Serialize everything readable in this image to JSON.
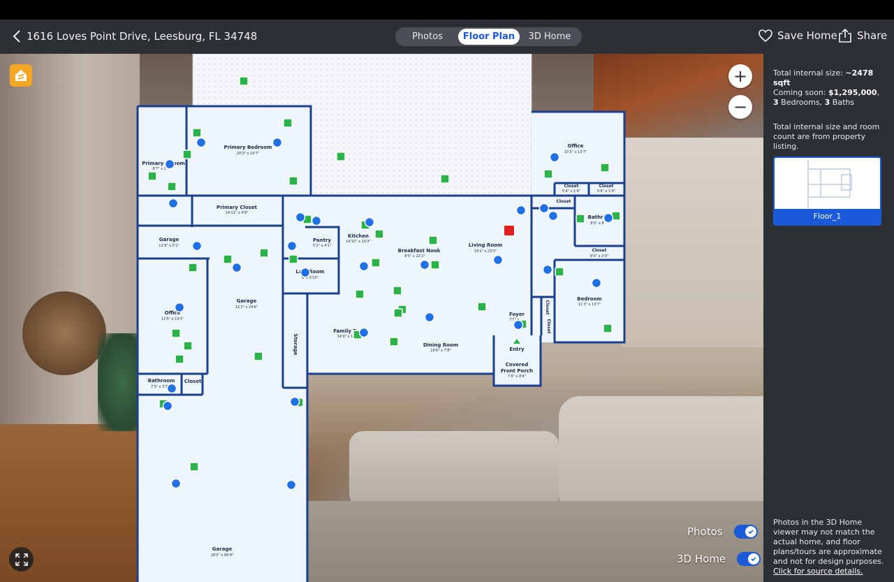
{
  "header": {
    "address": "1616 Loves Point Drive, Leesburg, FL 34748",
    "tabs": [
      {
        "label": "Photos",
        "active": false
      },
      {
        "label": "Floor Plan",
        "active": true
      },
      {
        "label": "3D Home",
        "active": false
      }
    ],
    "save_label": "Save Home",
    "share_label": "Share"
  },
  "viewer": {
    "brand_icon": "zillow-home-icon",
    "zoom_in_label": "+",
    "zoom_out_label": "−",
    "toggles": [
      {
        "label": "Photos",
        "on": true
      },
      {
        "label": "3D Home",
        "on": true
      }
    ],
    "rooms": [
      {
        "name": "Primary Bedroom",
        "dims": "20'3\" x 14'7\""
      },
      {
        "name": "Primary Bathroom",
        "name_visible": "Primary B     room",
        "dims": "8'7\" x 1"
      },
      {
        "name": "Primary Closet",
        "dims": "14'11\" x 4'9\""
      },
      {
        "name": "Garage",
        "dims": "11'9\" x 5'1\""
      },
      {
        "name": "Garage",
        "dims": "12'2\" x 24'6\""
      },
      {
        "name": "Office",
        "dims": "11'5\" x 19'1\""
      },
      {
        "name": "Bathroom",
        "dims": "7'3\" x 3'7\""
      },
      {
        "name": "Closet",
        "dims": ""
      },
      {
        "name": "Garage",
        "dims": "28'5\" x 60'4\""
      },
      {
        "name": "Pantry",
        "dims": "5'2\" x 4'1\""
      },
      {
        "name": "Kitchen",
        "dims": "14'10\" x 16'3\""
      },
      {
        "name": "Laundry Room",
        "name_visible": "La     y Room",
        "dims": "9'     x 5'10\""
      },
      {
        "name": "Storage",
        "dims": ""
      },
      {
        "name": "Family R",
        "dims": "14'9\" x 1"
      },
      {
        "name": "Breakfast Nook",
        "dims": "8'5\" x 22'2\""
      },
      {
        "name": "Living Room",
        "dims": "14'2\" x 23'3\""
      },
      {
        "name": "Dining Room",
        "dims": "16'6\" x 7'8\""
      },
      {
        "name": "Foyer",
        "dims": "7'7\" x"
      },
      {
        "name": "Entry",
        "dims": ""
      },
      {
        "name": "Covered Front Porch",
        "dims": "7'8\" x 8'4\""
      },
      {
        "name": "Office",
        "dims": "15'5\" x 13'7\""
      },
      {
        "name": "Closet",
        "dims": "5'4\" x 1'9\""
      },
      {
        "name": "Closet",
        "dims": "5'8\" x 1'9\""
      },
      {
        "name": "Closet",
        "dims": ""
      },
      {
        "name": "Bathroom",
        "name_visible": "Bathro",
        "dims": "8'0\" x 8"
      },
      {
        "name": "Closet",
        "dims": "8'0\" x 2'0\""
      },
      {
        "name": "Bedroom",
        "dims": "11'3\" x 13'7\""
      },
      {
        "name": "Closet",
        "dims": ""
      },
      {
        "name": "Closet",
        "dims": ""
      }
    ],
    "marker_colors": {
      "photo": "#2bb24a",
      "tour": "#1f6fe5",
      "current": "#e02020"
    }
  },
  "sidebar": {
    "size_label": "Total internal size: ",
    "size_value": "~2478 sqft",
    "coming_soon_prefix": "Coming soon: ",
    "price": "$1,295,000",
    "beds_count": "3",
    "beds_label": "Bedrooms",
    "baths_count": "3",
    "baths_label": "Baths",
    "listing_note": "Total internal size and room count are from property listing.",
    "floor_label": "Floor_1",
    "disclaimer": "Photos in the 3D Home viewer may not match the actual home, and floor plans/tours are approximate and not for design purposes.",
    "source_link": "Click for source details."
  },
  "colors": {
    "accent": "#1a5ad8",
    "header_bg": "#2c2f34",
    "brand": "#f5a623",
    "wall": "#1b3f8f",
    "room_fill": "#eef5fd"
  }
}
